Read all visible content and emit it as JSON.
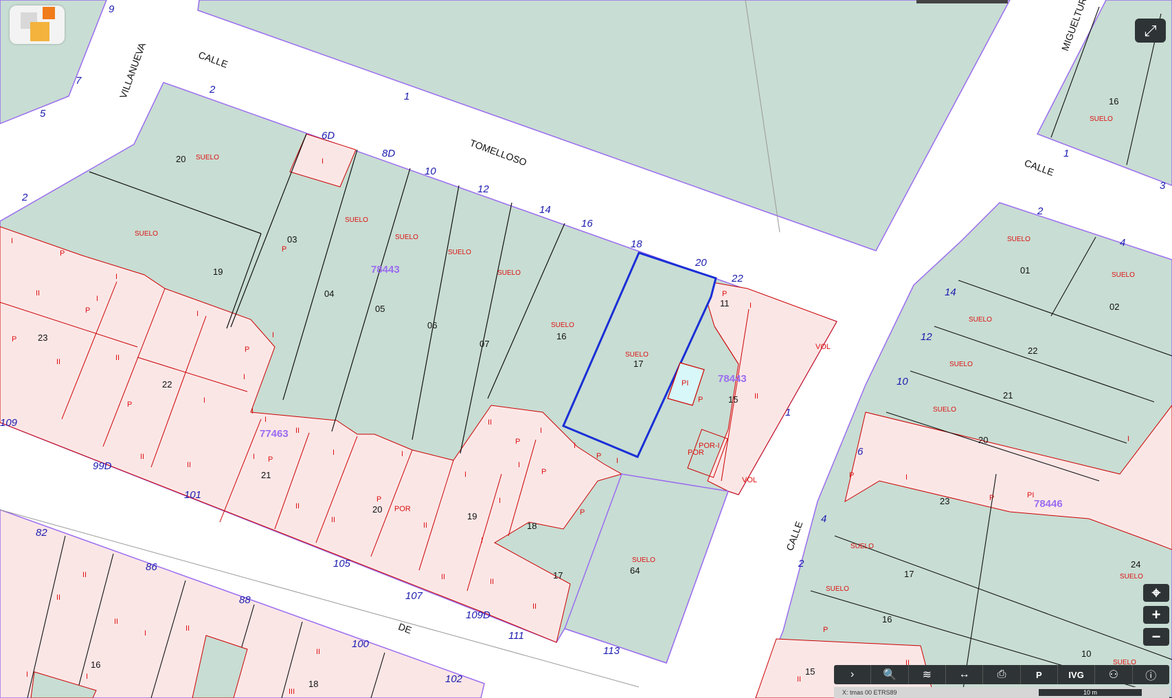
{
  "map": {
    "parcel_refs": [
      "78443",
      "78443",
      "77463",
      "78446"
    ],
    "street_names": [
      "CALLE",
      "VILLANUEVA",
      "TOMELLOSO",
      "CALLE",
      "CALLE",
      "MIGUELTURRA",
      "DE"
    ],
    "street_numbers": [
      "9",
      "7",
      "5",
      "2",
      "2",
      "1",
      "6D",
      "8D",
      "10",
      "12",
      "14",
      "16",
      "18",
      "20",
      "22",
      "109",
      "99D",
      "101",
      "82",
      "86",
      "88",
      "100",
      "102",
      "105",
      "107",
      "109D",
      "111",
      "113",
      "2",
      "4",
      "14",
      "12",
      "10",
      "6",
      "4",
      "2",
      "1",
      "1",
      "3"
    ],
    "unit_numbers": [
      "20",
      "19",
      "03",
      "04",
      "05",
      "06",
      "07",
      "16",
      "17",
      "15",
      "23",
      "22",
      "21",
      "20",
      "19",
      "18",
      "17",
      "64",
      "16",
      "18",
      "16",
      "01",
      "02",
      "22",
      "21",
      "20",
      "23",
      "17",
      "16",
      "15",
      "24",
      "10",
      "11"
    ],
    "labels": {
      "suelo": "SUELO",
      "p": "P",
      "i": "I",
      "ii": "II",
      "iii": "III",
      "por": "POR",
      "porpi": "POR-I",
      "pi": "PI",
      "vol": "VOL"
    }
  },
  "ui": {
    "fullscreen_icon": "expand-arrows-icon",
    "locate_symbol": "⌖",
    "zoom_in_symbol": "+",
    "zoom_out_symbol": "−",
    "toolbar": [
      {
        "name": "expand",
        "icon": "chevron-right-icon",
        "glyph": "›"
      },
      {
        "name": "search",
        "icon": "search-icon",
        "glyph": "🔍"
      },
      {
        "name": "layers",
        "icon": "layers-icon",
        "glyph": "≋"
      },
      {
        "name": "measure",
        "icon": "measure-icon",
        "glyph": "↔"
      },
      {
        "name": "print",
        "icon": "print-icon",
        "glyph": "⎙"
      },
      {
        "name": "reference",
        "icon": "reference-icon",
        "glyph": "P"
      },
      {
        "name": "ivg",
        "icon": "ivg-icon",
        "glyph": "IVG"
      },
      {
        "name": "share",
        "icon": "share-icon",
        "glyph": "⚇"
      },
      {
        "name": "info",
        "icon": "info-icon",
        "glyph": "ⓘ"
      }
    ],
    "status_text": "X: tmas  00 ETRS89",
    "scale_label": "10 m"
  },
  "colors": {
    "green_parcel": "#c8ddd3",
    "pink_parcel": "#fbe6e6",
    "cyan_parcel": "#d8f7f8",
    "parcel_border": "#9b6cf0",
    "inner_line": "#111111",
    "red_line": "#cc0000",
    "label_red": "#d11",
    "number_blue": "#1c1cb0",
    "ref_purple": "#9b6cf0",
    "selected_blue": "#1a2fd6"
  }
}
